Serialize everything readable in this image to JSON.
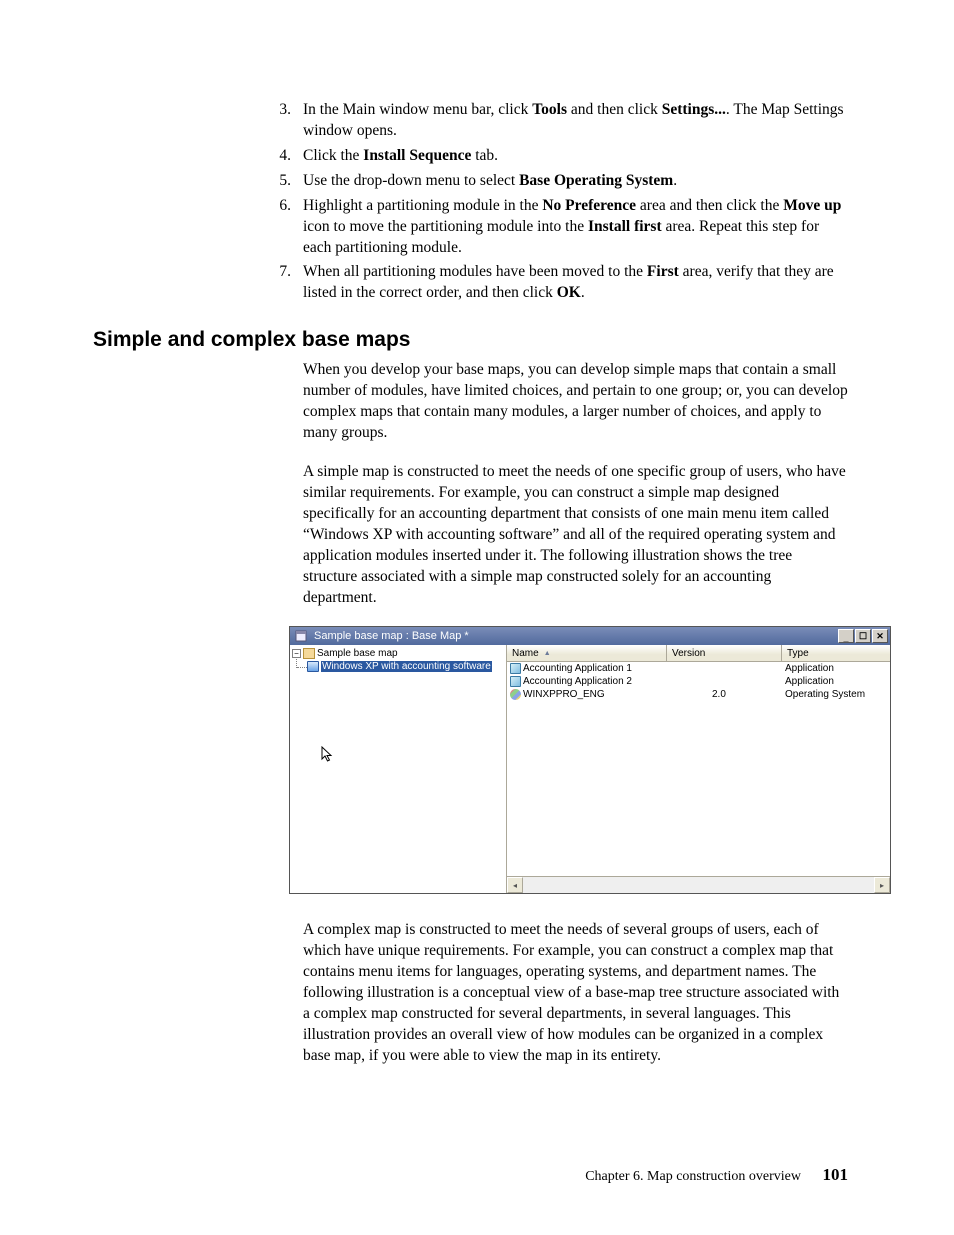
{
  "steps": [
    {
      "n": "3.",
      "runs": [
        {
          "t": "In the Main window menu bar, click "
        },
        {
          "t": "Tools",
          "b": true
        },
        {
          "t": " and then click "
        },
        {
          "t": "Settings...",
          "b": true
        },
        {
          "t": ". The Map Settings window opens."
        }
      ]
    },
    {
      "n": "4.",
      "runs": [
        {
          "t": "Click the "
        },
        {
          "t": "Install Sequence",
          "b": true
        },
        {
          "t": " tab."
        }
      ]
    },
    {
      "n": "5.",
      "runs": [
        {
          "t": "Use the drop-down menu to select "
        },
        {
          "t": "Base Operating System",
          "b": true
        },
        {
          "t": "."
        }
      ]
    },
    {
      "n": "6.",
      "runs": [
        {
          "t": "Highlight a partitioning module in the "
        },
        {
          "t": "No Preference",
          "b": true
        },
        {
          "t": " area and then click the "
        },
        {
          "t": "Move up",
          "b": true
        },
        {
          "t": " icon to move the partitioning module into the "
        },
        {
          "t": "Install first",
          "b": true
        },
        {
          "t": " area. Repeat this step for each partitioning module."
        }
      ]
    },
    {
      "n": "7.",
      "runs": [
        {
          "t": "When all partitioning modules have been moved to the "
        },
        {
          "t": "First",
          "b": true
        },
        {
          "t": " area, verify that they are listed in the correct order, and then click "
        },
        {
          "t": "OK",
          "b": true
        },
        {
          "t": "."
        }
      ]
    }
  ],
  "heading": "Simple and complex base maps",
  "para1": "When you develop your base maps, you can develop simple maps that contain a small number of modules, have limited choices, and pertain to one group; or, you can develop complex maps that contain many modules, a larger number of choices, and apply to many groups.",
  "para2": "A simple map is constructed to meet the needs of one specific group of users, who have similar requirements. For example, you can construct a simple map designed specifically for an accounting department that consists of one main menu item called “Windows XP with accounting software” and all of the required operating system and application modules inserted under it. The following illustration shows the tree structure associated with a simple map constructed solely for an accounting department.",
  "para3": "A complex map is constructed to meet the needs of several groups of users, each of which have unique requirements. For example, you can construct a complex map that contains menu items for languages, operating systems, and department names. The following illustration is a conceptual view of a base-map tree structure associated with a complex map constructed for several departments, in several languages. This illustration provides an overall view of how modules can be organized in a complex base map, if you were able to view the map in its entirety.",
  "window": {
    "title": "Sample base map : Base Map *",
    "controls": {
      "min": "_",
      "max": "☐",
      "close": "✕"
    },
    "tree": {
      "root": "Sample base map",
      "child": "Windows XP with accounting software",
      "expander": "−"
    },
    "columns": {
      "name": "Name",
      "version": "Version",
      "type": "Type",
      "sort": "▲"
    },
    "rows": [
      {
        "name": "Accounting Application 1",
        "version": "",
        "type": "Application",
        "iconClass": "app-icon"
      },
      {
        "name": "Accounting Application 2",
        "version": "",
        "type": "Application",
        "iconClass": "app-icon"
      },
      {
        "name": "WINXPPRO_ENG",
        "version": "2.0",
        "type": "Operating System",
        "iconClass": "os-icon"
      }
    ],
    "scroll": {
      "left": "◂",
      "right": "▸"
    }
  },
  "footer": {
    "chapter": "Chapter 6. Map construction overview",
    "page": "101"
  }
}
